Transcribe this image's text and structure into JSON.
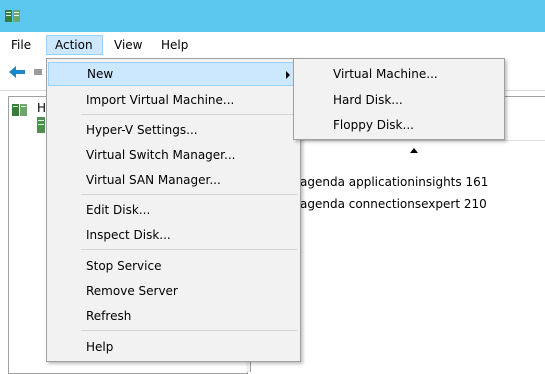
{
  "window": {
    "app_icon": "hyper-v-manager-icon"
  },
  "menubar": {
    "items": [
      {
        "label": "File"
      },
      {
        "label": "Action"
      },
      {
        "label": "View"
      },
      {
        "label": "Help"
      }
    ]
  },
  "toolbar": {
    "back_icon": "back-arrow-icon"
  },
  "tree": {
    "root_label": "H"
  },
  "vm_list": {
    "rows": [
      {
        "name": "agenda applicationinsights 161"
      },
      {
        "name": "agenda connectionsexpert 210"
      }
    ]
  },
  "action_menu": {
    "items": [
      {
        "label": "New"
      },
      {
        "label": "Import Virtual Machine..."
      },
      {
        "label": "Hyper-V Settings..."
      },
      {
        "label": "Virtual Switch Manager..."
      },
      {
        "label": "Virtual SAN Manager..."
      },
      {
        "label": "Edit Disk..."
      },
      {
        "label": "Inspect Disk..."
      },
      {
        "label": "Stop Service"
      },
      {
        "label": "Remove Server"
      },
      {
        "label": "Refresh"
      },
      {
        "label": "Help"
      }
    ]
  },
  "new_submenu": {
    "items": [
      {
        "label": "Virtual Machine..."
      },
      {
        "label": "Hard Disk..."
      },
      {
        "label": "Floppy Disk..."
      }
    ]
  },
  "colors": {
    "titlebar": "#5bc9ef",
    "menu_highlight": "#cce8ff",
    "menu_highlight_border": "#99d1ff",
    "menu_background": "#f2f2f2"
  }
}
